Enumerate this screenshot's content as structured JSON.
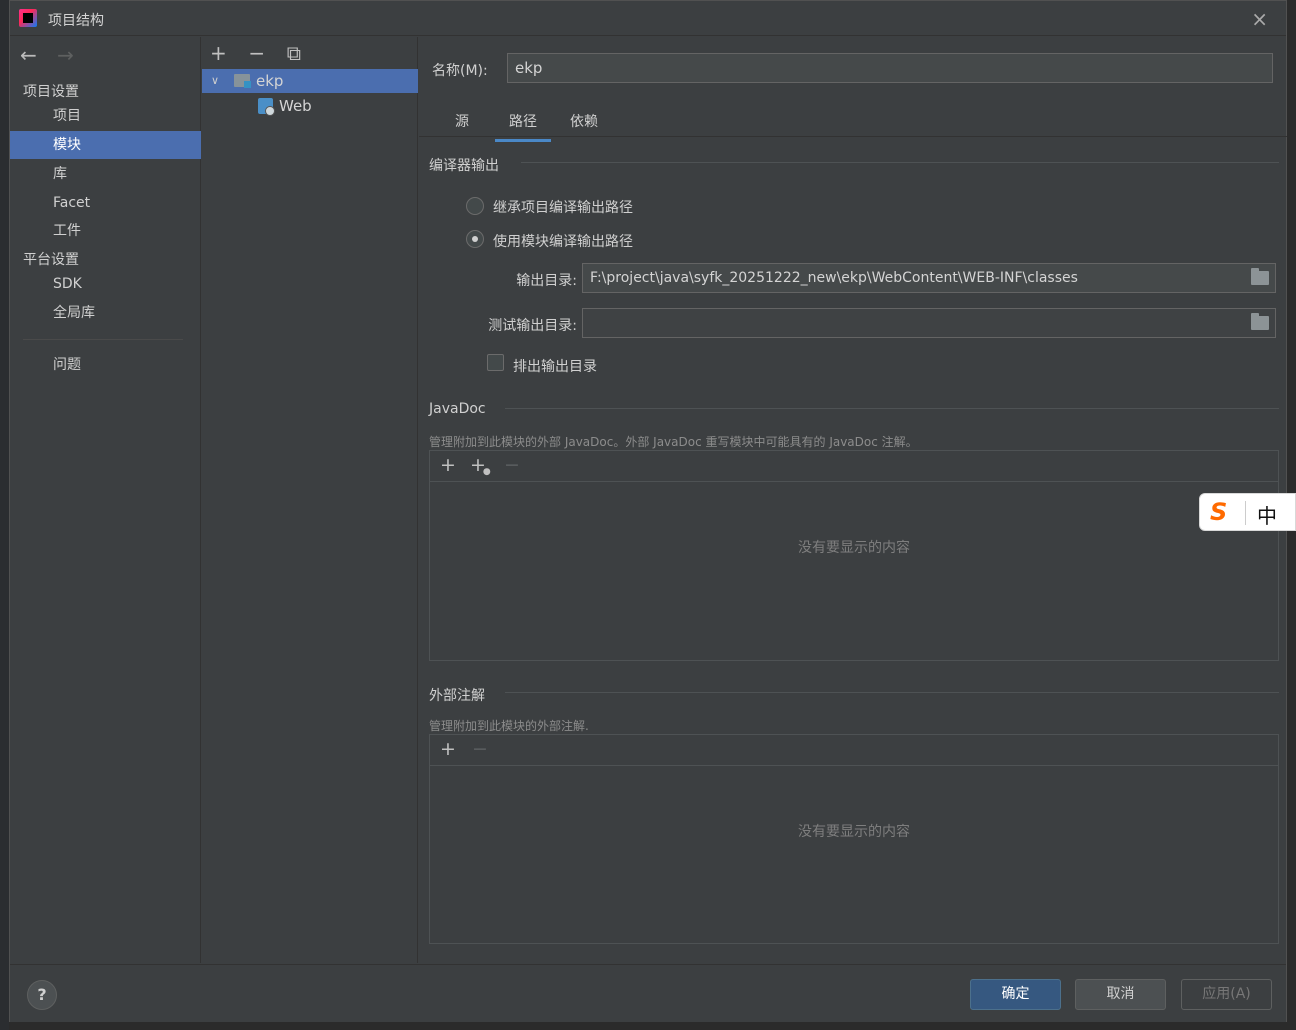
{
  "window": {
    "title": "项目结构",
    "close_icon": "×"
  },
  "nav": {
    "back_arrow": "←",
    "forward_arrow": "→",
    "project_settings_header": "项目设置",
    "platform_settings_header": "平台设置",
    "items": [
      {
        "label": "项目"
      },
      {
        "label": "模块"
      },
      {
        "label": "库"
      },
      {
        "label": "Facet"
      },
      {
        "label": "工件"
      },
      {
        "label": "SDK"
      },
      {
        "label": "全局库"
      },
      {
        "label": "问题"
      }
    ]
  },
  "tree": {
    "toolbar": {
      "add": "+",
      "remove": "−",
      "copy": "⧉"
    },
    "nodes": [
      {
        "label": "ekp"
      },
      {
        "label": "Web"
      }
    ]
  },
  "module": {
    "name_label": "名称(M):",
    "name_value": "ekp",
    "tabs": [
      {
        "label": "源"
      },
      {
        "label": "路径"
      },
      {
        "label": "依赖"
      }
    ],
    "compiler_output": {
      "title": "编译器输出",
      "inherit_option": "继承项目编译输出路径",
      "module_option": "使用模块编译输出路径",
      "output_dir_label": "输出目录:",
      "output_dir_value": "F:\\project\\java\\syfk_20251222_new\\ekp\\WebContent\\WEB-INF\\classes",
      "test_output_dir_label": "测试输出目录:",
      "test_output_dir_value": "",
      "exclude_label": "排出输出目录"
    },
    "javadoc": {
      "title": "JavaDoc",
      "description": "管理附加到此模块的外部 JavaDoc。外部 JavaDoc 重写模块中可能具有的 JavaDoc 注解。",
      "add": "+",
      "add_url": "+",
      "remove": "−",
      "empty_text": "没有要显示的内容"
    },
    "annotations": {
      "title": "外部注解",
      "description": "管理附加到此模块的外部注解.",
      "add": "+",
      "remove": "−",
      "empty_text": "没有要显示的内容"
    }
  },
  "footer": {
    "help": "?",
    "ok": "确定",
    "cancel": "取消",
    "apply": "应用(A)"
  },
  "ime": {
    "logo": "S",
    "mode": "中"
  },
  "colors": {
    "selection": "#4b6eaf",
    "primary_button": "#365880",
    "tab_underline": "#4a88c7"
  }
}
